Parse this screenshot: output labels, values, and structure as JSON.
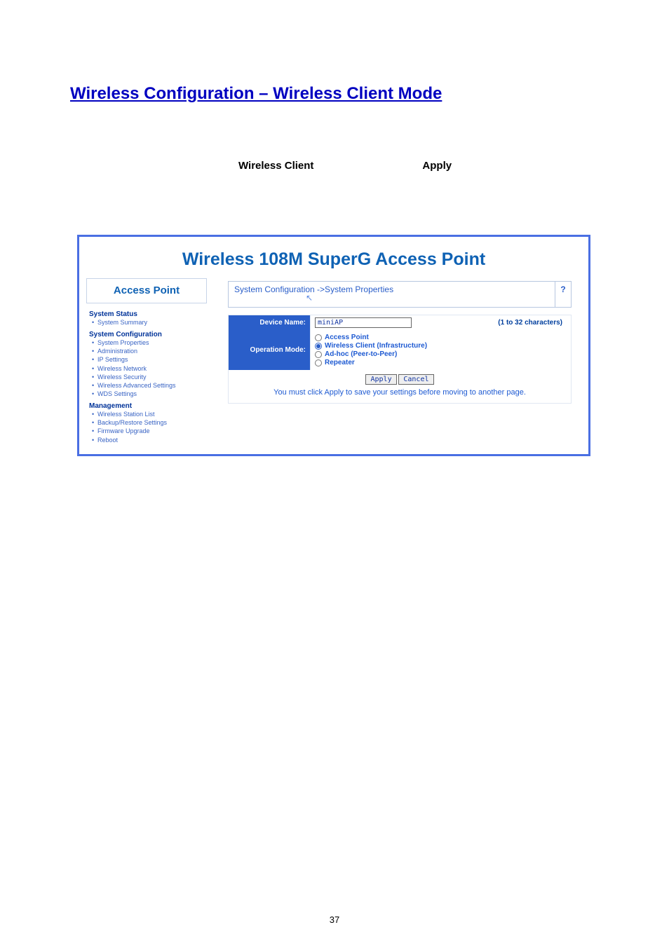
{
  "doc": {
    "section_heading": "Wireless Configuration – Wireless Client Mode",
    "label_wireless_client": "Wireless Client",
    "label_apply": "Apply",
    "page_number": "37"
  },
  "ui": {
    "banner_title": "Wireless 108M SuperG Access Point",
    "sidebar": {
      "title": "Access Point",
      "groups": [
        {
          "head": "System Status",
          "items": [
            "System Summary"
          ]
        },
        {
          "head": "System Configuration",
          "items": [
            "System Properties",
            "Administration",
            "IP Settings",
            "Wireless Network",
            "Wireless Security",
            "Wireless Advanced Settings",
            "WDS Settings"
          ]
        },
        {
          "head": "Management",
          "items": [
            "Wireless Station List",
            "Backup/Restore Settings",
            "Firmware Upgrade",
            "Reboot"
          ]
        }
      ]
    },
    "breadcrumb": "System Configuration ->System Properties",
    "help_symbol": "?",
    "form": {
      "device_name_label": "Device Name:",
      "device_name_value": "miniAP",
      "char_limit": "(1 to 32 characters)",
      "operation_mode_label": "Operation Mode:",
      "modes": {
        "access_point": "Access Point",
        "wireless_client": "Wireless Client (Infrastructure)",
        "adhoc": "Ad-hoc (Peer-to-Peer)",
        "repeater": "Repeater"
      },
      "apply_btn": "Apply",
      "cancel_btn": "Cancel",
      "note": "You must click Apply to save your settings before moving to another page."
    }
  }
}
